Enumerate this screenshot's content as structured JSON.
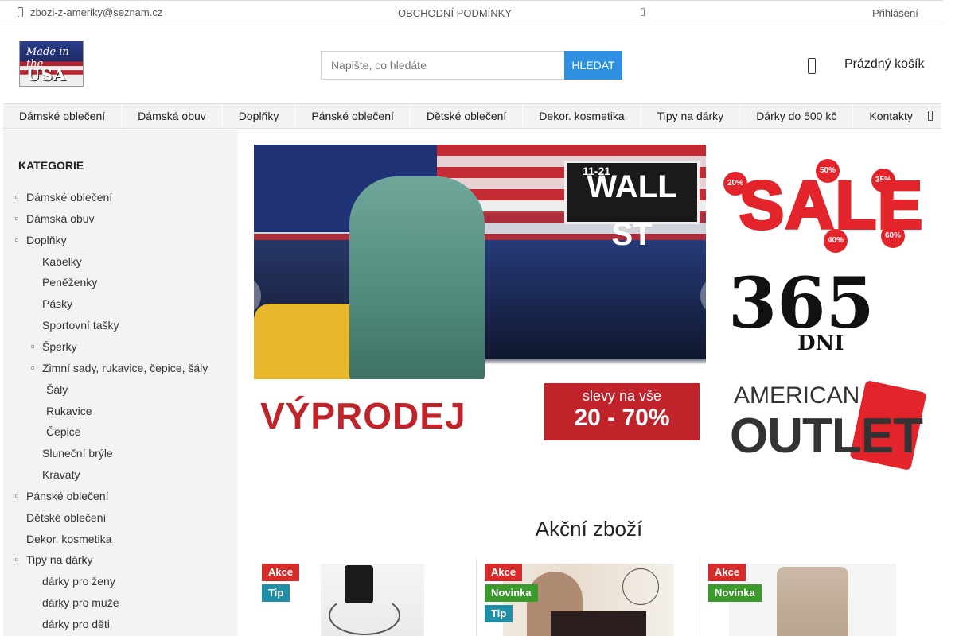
{
  "topbar": {
    "email": "zbozi-z-ameriky@seznam.cz",
    "conditions": "OBCHODNÍ PODMÍNKY",
    "login": "Přihlášení"
  },
  "header": {
    "logo_line1": "Made in the",
    "logo_line2": "USA",
    "search_placeholder": "Napište, co hledáte",
    "search_button": "HLEDAT",
    "cart_label": "Prázdný košík"
  },
  "nav": {
    "items": [
      "Dámské oblečení",
      "Dámská obuv",
      "Doplňky",
      "Pánské oblečení",
      "Dětské oblečení",
      "Dekor. kosmetika",
      "Tipy na dárky",
      "Dárky do 500 kč",
      "Kontakty"
    ]
  },
  "sidebar": {
    "heading": "KATEGORIE",
    "items": [
      {
        "label": "Dámské oblečení",
        "level": 0,
        "bullet": true
      },
      {
        "label": "Dámská obuv",
        "level": 0,
        "bullet": true
      },
      {
        "label": "Doplňky",
        "level": 0,
        "bullet": true
      },
      {
        "label": "Kabelky",
        "level": 1,
        "bullet": false
      },
      {
        "label": "Peněženky",
        "level": 1,
        "bullet": false
      },
      {
        "label": "Pásky",
        "level": 1,
        "bullet": false
      },
      {
        "label": "Sportovní tašky",
        "level": 1,
        "bullet": false
      },
      {
        "label": "Šperky",
        "level": 1,
        "bullet": true
      },
      {
        "label": "Zimní sady, rukavice, čepice, šály",
        "level": 1,
        "bullet": true
      },
      {
        "label": "Šály",
        "level": 2,
        "bullet": false
      },
      {
        "label": "Rukavice",
        "level": 2,
        "bullet": false
      },
      {
        "label": "Čepice",
        "level": 2,
        "bullet": false
      },
      {
        "label": "Sluneční brýle",
        "level": 1,
        "bullet": false
      },
      {
        "label": "Kravaty",
        "level": 1,
        "bullet": false
      },
      {
        "label": "Pánské oblečení",
        "level": 0,
        "bullet": true
      },
      {
        "label": "Dětské oblečení",
        "level": 0,
        "bullet": false
      },
      {
        "label": "Dekor. kosmetika",
        "level": 0,
        "bullet": false
      },
      {
        "label": "Tipy na dárky",
        "level": 0,
        "bullet": true
      },
      {
        "label": "dárky pro ženy",
        "level": 1,
        "bullet": false
      },
      {
        "label": "dárky pro muže",
        "level": 1,
        "bullet": false
      },
      {
        "label": "dárky pro děti",
        "level": 1,
        "bullet": false
      }
    ]
  },
  "banner": {
    "street_sign_numbers": "11-21",
    "street_sign": "WALL ST",
    "headline": "VÝPRODEJ",
    "discount_line1": "slevy na vše",
    "discount_line2": "20 - 70%"
  },
  "promos": {
    "sale": "SALE",
    "sale_tags": [
      "20%",
      "50%",
      "35%",
      "40%",
      "60%"
    ],
    "days_number": "365",
    "days_label": "DNI",
    "outlet_line1": "AMERICAN",
    "outlet_line2": "OUTLET"
  },
  "products": {
    "section_title": "Akční zboží",
    "cards": [
      {
        "flags": [
          "Akce",
          "Tip"
        ]
      },
      {
        "flags": [
          "Akce",
          "Novinka",
          "Tip"
        ]
      },
      {
        "flags": [
          "Akce",
          "Novinka"
        ]
      }
    ]
  },
  "colors": {
    "accent": "#2f8fe0",
    "flag_akce": "#d62b2b",
    "flag_tip": "#1f8ea6",
    "flag_novinka": "#3a9a2a",
    "sale_red": "#e3242b"
  }
}
